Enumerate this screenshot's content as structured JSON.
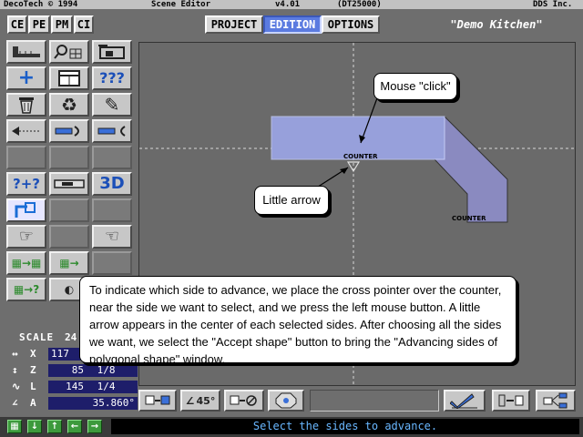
{
  "titlebar": {
    "company": "DecoTech © 1994",
    "app_title": "Scene Editor",
    "version": "v4.01",
    "build": "(DT25000)",
    "vendor": "DDS Inc."
  },
  "mode_tabs": [
    "CE",
    "PE",
    "PM",
    "CI"
  ],
  "main_tabs": {
    "project": "PROJECT",
    "edition": "EDITION",
    "options": "OPTIONS",
    "active": "EDITION"
  },
  "project_name": "\"Demo Kitchen\"",
  "toolbox": {
    "tools": [
      {
        "name": "ruler-tool",
        "glyph": "📏"
      },
      {
        "name": "search-grid-tool",
        "glyph": "🔍"
      },
      {
        "name": "room-tool",
        "glyph": "⌂"
      },
      {
        "name": "add-tool",
        "glyph": "+"
      },
      {
        "name": "cabinet-tool",
        "glyph": "▭"
      },
      {
        "name": "help-tool",
        "glyph": "???"
      },
      {
        "name": "trash-tool",
        "glyph": "🗑"
      },
      {
        "name": "recycle-tool",
        "glyph": "♻"
      },
      {
        "name": "pencil-tool",
        "glyph": "✎"
      },
      {
        "name": "dimension-tool",
        "glyph": "◁⇢"
      },
      {
        "name": "advance-tool",
        "glyph": "⇨"
      },
      {
        "name": "retract-tool",
        "glyph": "⇦"
      },
      {
        "name": "query-add-tool",
        "glyph": "?+?"
      },
      {
        "name": "counter-tool",
        "glyph": "▤"
      },
      {
        "name": "view-3d-button",
        "glyph": "3D"
      },
      {
        "name": "cross-pointer-tool",
        "glyph": "⌐⬚"
      },
      {
        "name": "hand-pointer-left-tool",
        "glyph": "☞"
      },
      {
        "name": "hand-pointer-right-tool",
        "glyph": "☜"
      },
      {
        "name": "grid-transfer-tool",
        "glyph": "▦→▦"
      },
      {
        "name": "grid-transfer-2-tool",
        "glyph": "▦→"
      },
      {
        "name": "grid-query-tool",
        "glyph": "▦→?"
      }
    ]
  },
  "scale": {
    "label": "SCALE",
    "value": "24",
    "x_label": "X",
    "x_value": "117",
    "z_label": "Z",
    "z_value": "85",
    "z_frac": "1/8",
    "l_label": "L",
    "l_value": "145",
    "l_frac": "1/4",
    "a_label": "A",
    "a_value": "35.860°"
  },
  "scene": {
    "counter_label_1": "COUNTER",
    "counter_label_2": "COUNTER"
  },
  "callouts": {
    "mouse_click": "Mouse \"click\"",
    "little_arrow": "Little arrow",
    "instructions": "To indicate which side to advance, we place the cross pointer over the counter, near the side we want to select, and we press the left mouse button. A little arrow appears in the center of each selected sides. After choosing all the sides we want, we select the \"Accept shape\" button to bring the \"Advancing sides of polygonal shape\" window."
  },
  "bottom_toolbar": {
    "angle_label": "45°"
  },
  "statusbar": {
    "message": "Select the sides to advance."
  },
  "colors": {
    "counter_fill": "#8a8ac0",
    "counter_selected": "#9aa4e0",
    "active_tab": "#5b7be0",
    "status_text": "#69b7ff"
  }
}
